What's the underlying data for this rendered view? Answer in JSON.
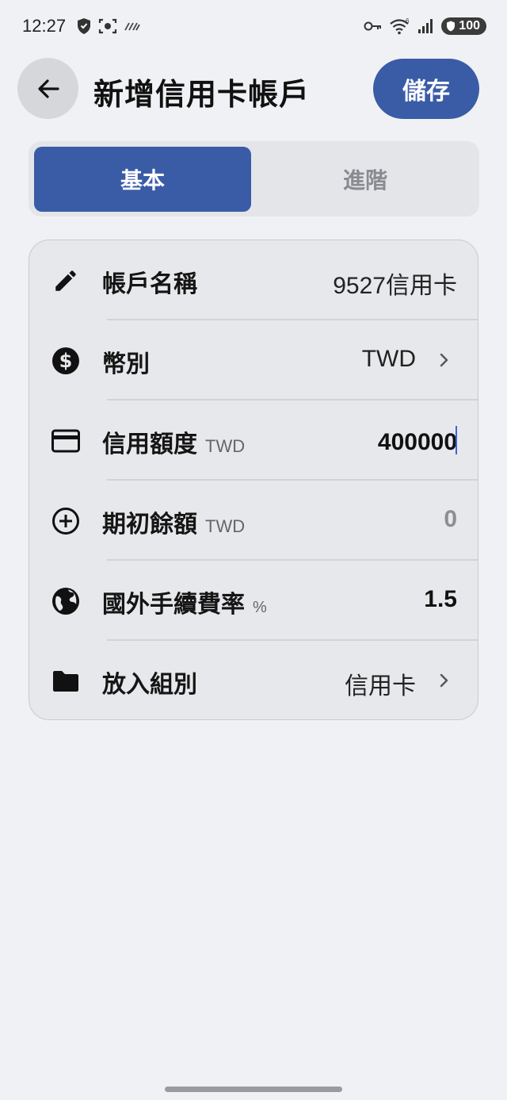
{
  "status_bar": {
    "time": "12:27",
    "battery": "100"
  },
  "header": {
    "title": "新增信用卡帳戶",
    "save_label": "儲存"
  },
  "tabs": [
    {
      "label": "基本",
      "active": true
    },
    {
      "label": "進階",
      "active": false
    }
  ],
  "form": {
    "rows": [
      {
        "icon": "pencil-icon",
        "label": "帳戶名稱",
        "unit": "",
        "value": "9527信用卡"
      },
      {
        "icon": "dollar-circle-icon",
        "label": "幣別",
        "unit": "",
        "value": "TWD"
      },
      {
        "icon": "credit-card-icon",
        "label": "信用額度",
        "unit": "TWD",
        "value": "400000"
      },
      {
        "icon": "plus-circle-icon",
        "label": "期初餘額",
        "unit": "TWD",
        "value": "0"
      },
      {
        "icon": "globe-icon",
        "label": "國外手續費率",
        "unit": "%",
        "value": "1.5"
      },
      {
        "icon": "folder-icon",
        "label": "放入組別",
        "unit": "",
        "value": "信用卡"
      }
    ]
  },
  "colors": {
    "accent": "#3a5ba6",
    "background": "#f0f1f4",
    "card": "#e7e8eb"
  }
}
